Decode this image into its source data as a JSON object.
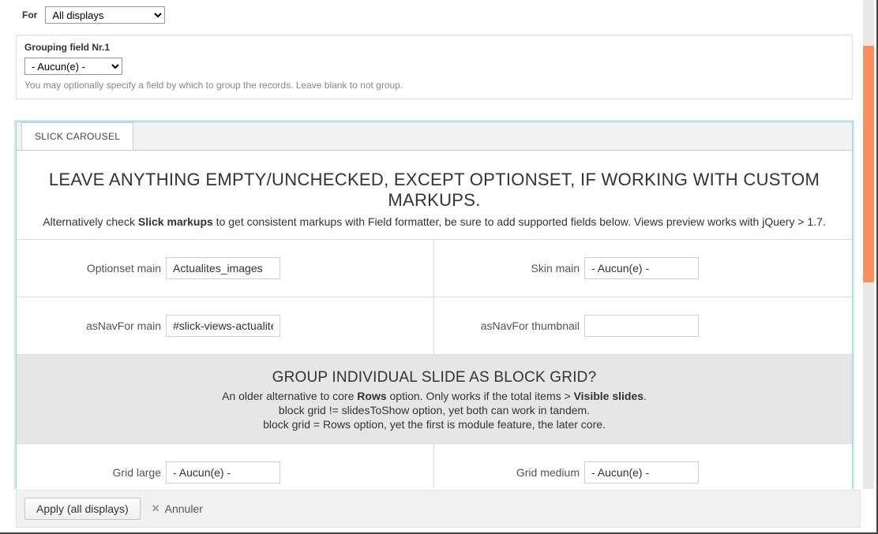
{
  "for_row": {
    "label": "For",
    "value": "All displays"
  },
  "grouping": {
    "title": "Grouping field Nr.1",
    "value": "- Aucun(e) -",
    "help": "You may optionally specify a field by which to group the records. Leave blank to not group."
  },
  "tab": {
    "label": "SLICK CAROUSEL"
  },
  "head": {
    "title": "LEAVE ANYTHING EMPTY/UNCHECKED, EXCEPT OPTIONSET, IF WORKING WITH CUSTOM MARKUPS.",
    "sub_pre": "Alternatively check ",
    "sub_bold": "Slick markups",
    "sub_post": " to get consistent markups with Field formatter, be sure to add supported fields below. Views preview works with jQuery > 1.7."
  },
  "fields": {
    "optionset_main": {
      "label": "Optionset main",
      "value": "Actualites_images"
    },
    "skin_main": {
      "label": "Skin main",
      "value": "- Aucun(e) -"
    },
    "asnav_main": {
      "label": "asNavFor main",
      "value": "#slick-views-actualite"
    },
    "asnav_thumb": {
      "label": "asNavFor thumbnail",
      "value": ""
    },
    "grid_large": {
      "label": "Grid large",
      "value": "- Aucun(e) -"
    },
    "grid_medium": {
      "label": "Grid medium",
      "value": "- Aucun(e) -"
    }
  },
  "grid_head": {
    "title": "GROUP INDIVIDUAL SLIDE AS BLOCK GRID?",
    "l1_pre": "An older alternative to core ",
    "l1_b1": "Rows",
    "l1_mid": " option. Only works if the total items > ",
    "l1_b2": "Visible slides",
    "l1_post": ".",
    "l2": "block grid != slidesToShow option, yet both can work in tandem.",
    "l3": "block grid = Rows option, yet the first is module feature, the later core."
  },
  "footer": {
    "apply": "Apply (all displays)",
    "cancel": "Annuler"
  }
}
